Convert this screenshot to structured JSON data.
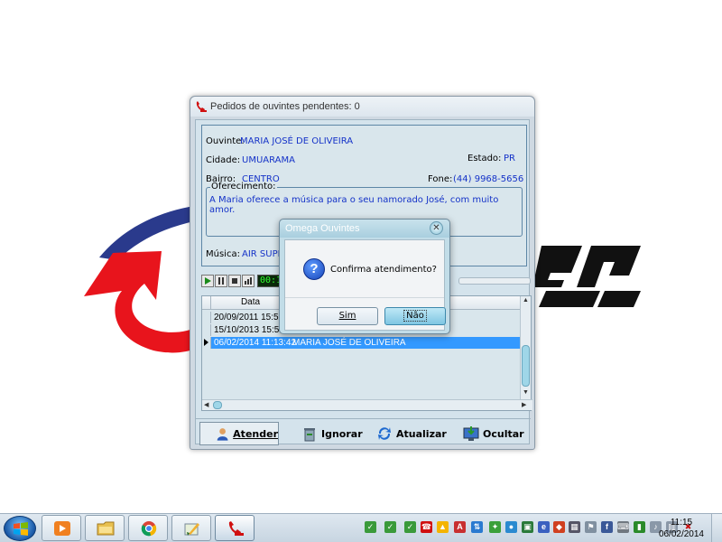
{
  "window": {
    "title": "Pedidos de ouvintes pendentes: 0"
  },
  "listener": {
    "ouvinte_label": "Ouvinte:",
    "ouvinte_value": "MARIA JOSÉ DE OLIVEIRA",
    "cidade_label": "Cidade:",
    "cidade_value": "UMUARAMA",
    "estado_label": "Estado:",
    "estado_value": "PR",
    "bairro_label": "Bairro:",
    "bairro_value": "CENTRO",
    "fone_label": "Fone:",
    "fone_value": "(44) 9968-5656",
    "oferecimento_label": "Oferecimento:",
    "oferecimento_value": "A Maria oferece a música para o seu namorado José, com muito amor.",
    "musica_label": "Música:",
    "musica_value": "AIR SUPL"
  },
  "player": {
    "display": "00:1"
  },
  "grid": {
    "header_data": "Data",
    "rows": [
      {
        "data": "20/09/2011 15:52:5",
        "ouvinte": ""
      },
      {
        "data": "15/10/2013 15:56:4",
        "ouvinte": ""
      },
      {
        "data": "06/02/2014 11:13:42",
        "ouvinte": "MARIA JOSÉ DE OLIVEIRA"
      }
    ]
  },
  "buttons": {
    "atender": "Atender",
    "ignorar": "Ignorar",
    "atualizar": "Atualizar",
    "ocultar": "Ocultar"
  },
  "dialog": {
    "title": "Omega Ouvintes",
    "message": "Confirma atendimento?",
    "yes": "Sim",
    "no": "Não",
    "icon": "question-icon"
  },
  "taskbar": {
    "apps": [
      "media-player-icon",
      "file-explorer-icon",
      "chrome-icon",
      "paint-brush-icon",
      "omega-phone-icon"
    ],
    "clock_time": "11:15",
    "clock_date": "06/02/2014"
  },
  "colors": {
    "value_blue": "#1432c8",
    "selection": "#3399ff",
    "logo_red": "#e8141c",
    "logo_blue": "#2a3a8c"
  }
}
